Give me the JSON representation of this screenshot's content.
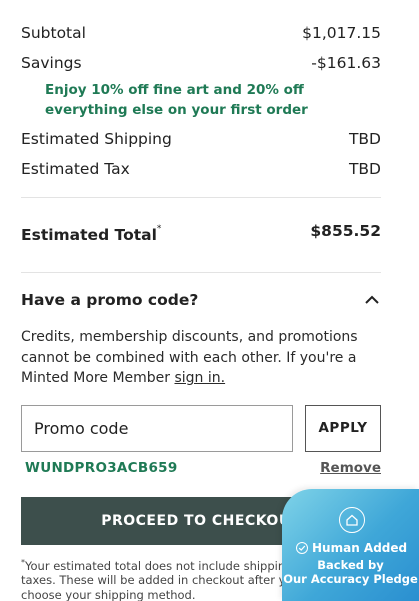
{
  "summary": {
    "subtotal_label": "Subtotal",
    "subtotal_value": "$1,017.15",
    "savings_label": "Savings",
    "savings_value": "-$161.63",
    "promo_note": "Enjoy 10% off fine art and 20% off everything else on your first order",
    "shipping_label": "Estimated Shipping",
    "shipping_value": "TBD",
    "tax_label": "Estimated Tax",
    "tax_value": "TBD",
    "total_label": "Estimated Total",
    "total_marker": "*",
    "total_value": "$855.52"
  },
  "promo": {
    "heading": "Have a promo code?",
    "toggle_icon": "chevron-up-icon",
    "disclaimer": "Credits, membership discounts, and promotions cannot be combined with each other. If you're a Minted More Member ",
    "sign_in_link": "sign in.",
    "input_placeholder": "Promo code",
    "apply_label": "APPLY",
    "applied_code": "WUNDPRO3ACB659",
    "remove_label": "Remove"
  },
  "checkout": {
    "button_label": "PROCEED TO CHECKOUT"
  },
  "footnote": {
    "marker": "*",
    "text": "Your estimated total does not include shipping or taxes. These will be added in checkout after you choose your shipping method."
  },
  "badge": {
    "line1": "Human Added",
    "line2": "Backed by",
    "line3": "Our Accuracy Pledge",
    "colors": {
      "start": "#7fd3e8",
      "end": "#2a8fd0"
    }
  },
  "colors": {
    "accent_green": "#1f7a55",
    "checkout_bg": "#3d4f4c"
  }
}
